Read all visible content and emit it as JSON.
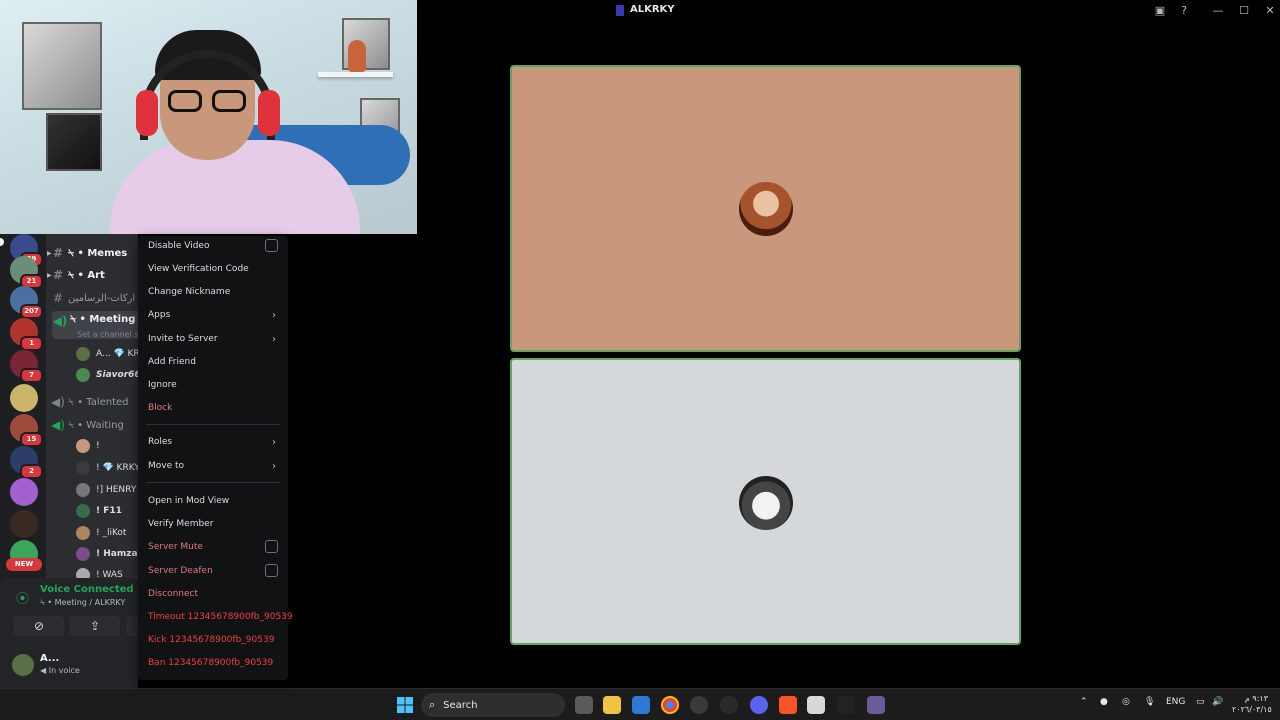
{
  "window": {
    "title": "ALKRKY",
    "controls": [
      "screen-share-icon",
      "help-icon",
      "minimize-icon",
      "maximize-icon",
      "close-icon"
    ]
  },
  "guilds": [
    {
      "badge": "99",
      "color": "#3b4a8f"
    },
    {
      "badge": "21",
      "color": "#6a8f78"
    },
    {
      "badge": "207",
      "color": "#4a6fa0"
    },
    {
      "badge": "1",
      "color": "#b0332c"
    },
    {
      "badge": "7",
      "color": "#7a2636"
    },
    {
      "badge": "",
      "color": "#c9b46a"
    },
    {
      "badge": "15",
      "color": "#a04a3c"
    },
    {
      "badge": "2",
      "color": "#2c3d6c"
    },
    {
      "badge": "",
      "color": "#a45fd0"
    },
    {
      "badge": "",
      "color": "#3a2a24"
    },
    {
      "badge": "",
      "color": "#3ba55c"
    }
  ],
  "new_badge": "NEW",
  "channels": {
    "items": [
      {
        "glyph": "#",
        "label": "⍀ • Memes",
        "bold": true
      },
      {
        "glyph": "#",
        "label": "⍀ • Art",
        "bold": true
      },
      {
        "glyph": "#",
        "label": "اركات-الرسامين",
        "bold": false
      },
      {
        "glyph": "🔊",
        "label": "⍀ • Meeting",
        "bold": true
      },
      {
        "glyph": "🔊",
        "label": "⍀ • Talented",
        "bold": false
      },
      {
        "glyph": "🔊",
        "label": "⍀ • Waiting",
        "bold": false
      }
    ],
    "meeting_status": "Set a channel sta",
    "meeting_users": [
      {
        "name": "A... 💎 KR",
        "color": "#5b6e47"
      },
      {
        "name": "Siavor66",
        "color": "#4b8a4f"
      }
    ],
    "waiting_users": [
      {
        "name": "!",
        "color": "#c9977b"
      },
      {
        "name": "! 💎 KRKY",
        "color": "#3b3b3b"
      },
      {
        "name": "!] HENRY",
        "color": "#777"
      },
      {
        "name": "! F11",
        "color": "#3a6b4a"
      },
      {
        "name": "! _liKot",
        "color": "#b0835e"
      },
      {
        "name": "! Hamza",
        "color": "#7a4a8a"
      },
      {
        "name": "! WAS",
        "color": "#aaa"
      }
    ]
  },
  "voice": {
    "status": "Voice Connected",
    "channel": "⍀ • Meeting / ALKRKY"
  },
  "user": {
    "name": "A...",
    "status": "In voice"
  },
  "context_menu": {
    "disable_video": "Disable Video",
    "view_verification": "View Verification Code",
    "change_nickname": "Change Nickname",
    "apps": "Apps",
    "invite": "Invite to Server",
    "add_friend": "Add Friend",
    "ignore": "Ignore",
    "block": "Block",
    "roles": "Roles",
    "move_to": "Move to",
    "mod_view": "Open in Mod View",
    "verify": "Verify Member",
    "server_mute": "Server Mute",
    "server_deafen": "Server Deafen",
    "disconnect": "Disconnect",
    "timeout": "Timeout 12345678900fb_90539",
    "kick": "Kick 12345678900fb_90539",
    "ban": "Ban 12345678900fb_90539"
  },
  "taskbar": {
    "search_placeholder": "Search",
    "language": "ENG",
    "time": "٩:١٣ م",
    "date": "٢٠٢٦/٠٣/١٥"
  },
  "colors": {
    "speaking_border": "#5ea760",
    "tile1_bg": "#c9977b",
    "tile2_bg": "#d5d8da",
    "danger": "#f23f43"
  }
}
